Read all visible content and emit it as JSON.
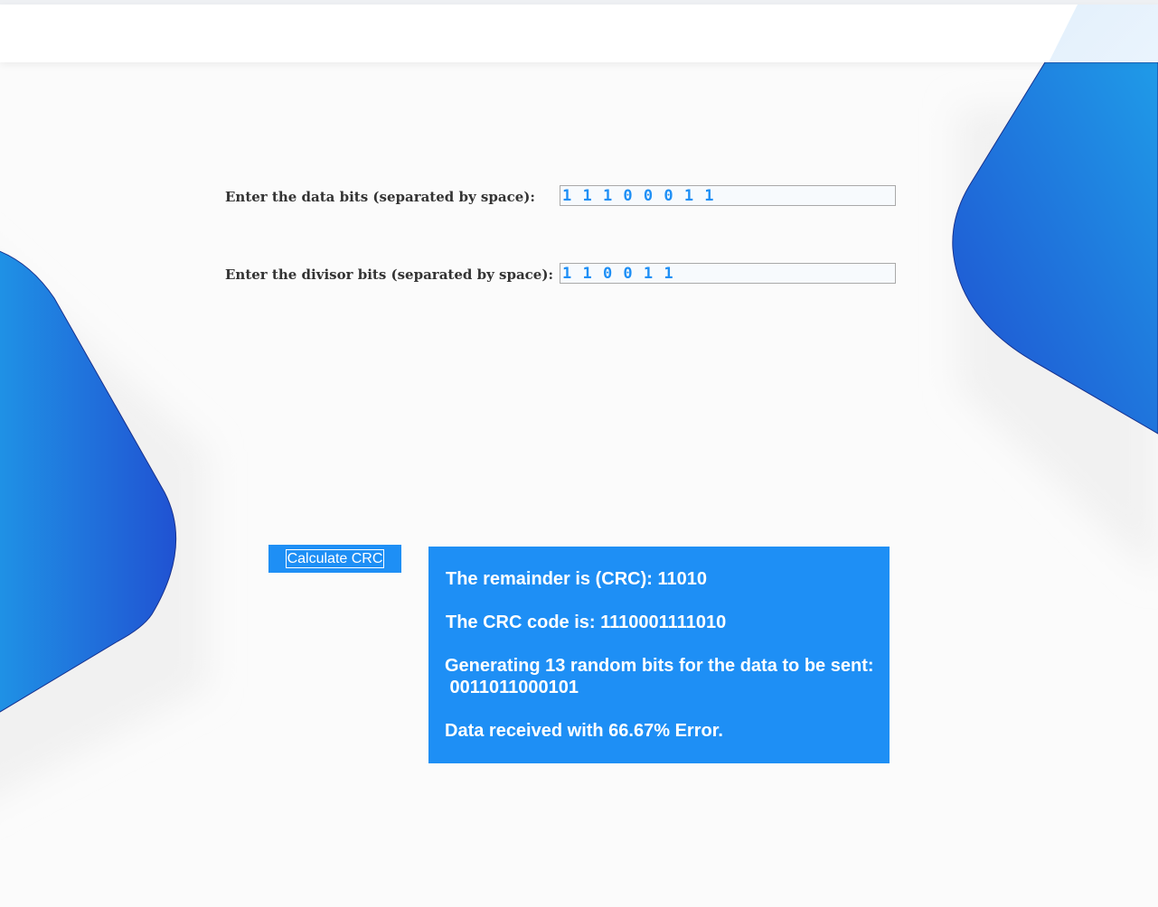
{
  "form": {
    "data_bits": {
      "label": "Enter the data bits (separated by space):",
      "value": "1 1 1 0 0 0 1 1"
    },
    "divisor_bits": {
      "label": "Enter the divisor bits (separated by space):",
      "value": "1 1 0 0 1 1"
    },
    "calculate_label": "Calculate CRC"
  },
  "result": {
    "remainder": "The remainder is (CRC): 11010",
    "crc_code": "The CRC code is: 1110001111010",
    "random_header": "Generating 13 random bits for the data to be sent:",
    "random_bits": " 0011011000101",
    "error": "Data received with 66.67% Error."
  },
  "colors": {
    "accent": "#1e8ff5",
    "shape_light": "#1f9be8",
    "shape_dark": "#1f4fd0",
    "label_text": "#333333"
  }
}
